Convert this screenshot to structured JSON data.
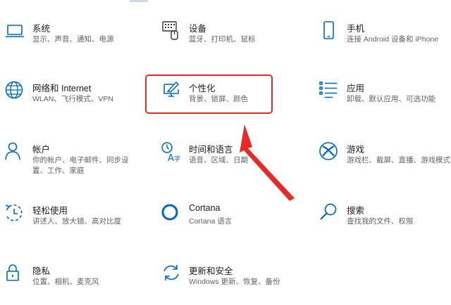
{
  "settings": [
    {
      "title": "系统",
      "sub": "显示、声音、通知、电源",
      "icon": "laptop-icon"
    },
    {
      "title": "设备",
      "sub": "蓝牙、打印机、鼠标",
      "icon": "keyboard-icon"
    },
    {
      "title": "手机",
      "sub": "连接 Android 设备和 iPhone",
      "icon": "phone-icon"
    },
    {
      "title": "网络和 Internet",
      "sub": "WLAN、飞行模式、VPN",
      "icon": "globe-icon"
    },
    {
      "title": "个性化",
      "sub": "背景、锁屏、颜色",
      "icon": "paint-brush-icon"
    },
    {
      "title": "应用",
      "sub": "卸载、默认应用、可选功能",
      "icon": "apps-list-icon"
    },
    {
      "title": "帐户",
      "sub": "你的帐户、电子邮件、同步设置、工作、家庭",
      "icon": "person-icon"
    },
    {
      "title": "时间和语言",
      "sub": "语音、区域、日期",
      "icon": "time-language-icon"
    },
    {
      "title": "游戏",
      "sub": "游戏栏、截屏、直播、游戏模式",
      "icon": "xbox-icon"
    },
    {
      "title": "轻松使用",
      "sub": "讲述人、放大镜、高对比度",
      "icon": "ease-of-access-icon"
    },
    {
      "title": "Cortana",
      "sub": "Cortana 语言",
      "icon": "cortana-icon"
    },
    {
      "title": "搜索",
      "sub": "查找我的文件、权限",
      "icon": "search-icon"
    },
    {
      "title": "隐私",
      "sub": "位置、相机、麦克风",
      "icon": "lock-icon"
    },
    {
      "title": "更新和安全",
      "sub": "Windows 更新、恢复、备份",
      "icon": "update-icon"
    }
  ],
  "sub_wrap": {
    "account_line1": "你的帐户、电子邮件、同步设",
    "account_line2": "置、工作、家庭"
  },
  "colors": {
    "icon_blue": "#0067c0",
    "highlight_red": "#e52a28"
  }
}
